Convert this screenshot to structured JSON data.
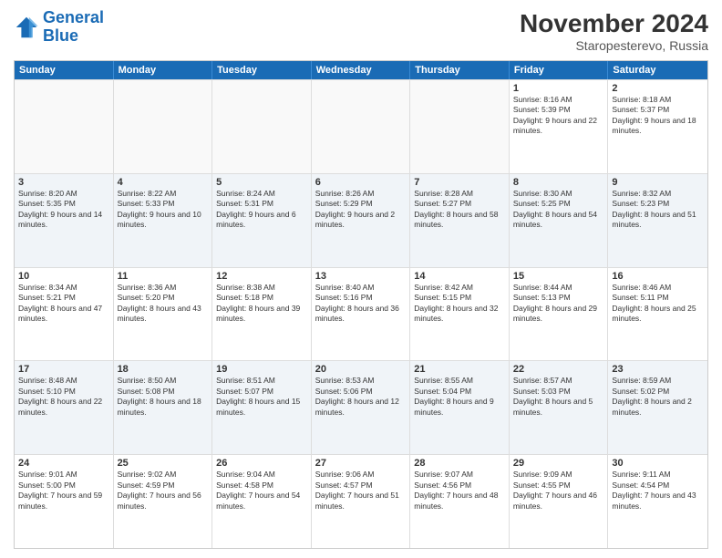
{
  "logo": {
    "text_general": "General",
    "text_blue": "Blue"
  },
  "header": {
    "title": "November 2024",
    "subtitle": "Staropesterevo, Russia"
  },
  "days_of_week": [
    "Sunday",
    "Monday",
    "Tuesday",
    "Wednesday",
    "Thursday",
    "Friday",
    "Saturday"
  ],
  "weeks": [
    [
      {
        "day": "",
        "info": "",
        "empty": true
      },
      {
        "day": "",
        "info": "",
        "empty": true
      },
      {
        "day": "",
        "info": "",
        "empty": true
      },
      {
        "day": "",
        "info": "",
        "empty": true
      },
      {
        "day": "",
        "info": "",
        "empty": true
      },
      {
        "day": "1",
        "info": "Sunrise: 8:16 AM\nSunset: 5:39 PM\nDaylight: 9 hours and 22 minutes.",
        "empty": false
      },
      {
        "day": "2",
        "info": "Sunrise: 8:18 AM\nSunset: 5:37 PM\nDaylight: 9 hours and 18 minutes.",
        "empty": false
      }
    ],
    [
      {
        "day": "3",
        "info": "Sunrise: 8:20 AM\nSunset: 5:35 PM\nDaylight: 9 hours and 14 minutes.",
        "empty": false
      },
      {
        "day": "4",
        "info": "Sunrise: 8:22 AM\nSunset: 5:33 PM\nDaylight: 9 hours and 10 minutes.",
        "empty": false
      },
      {
        "day": "5",
        "info": "Sunrise: 8:24 AM\nSunset: 5:31 PM\nDaylight: 9 hours and 6 minutes.",
        "empty": false
      },
      {
        "day": "6",
        "info": "Sunrise: 8:26 AM\nSunset: 5:29 PM\nDaylight: 9 hours and 2 minutes.",
        "empty": false
      },
      {
        "day": "7",
        "info": "Sunrise: 8:28 AM\nSunset: 5:27 PM\nDaylight: 8 hours and 58 minutes.",
        "empty": false
      },
      {
        "day": "8",
        "info": "Sunrise: 8:30 AM\nSunset: 5:25 PM\nDaylight: 8 hours and 54 minutes.",
        "empty": false
      },
      {
        "day": "9",
        "info": "Sunrise: 8:32 AM\nSunset: 5:23 PM\nDaylight: 8 hours and 51 minutes.",
        "empty": false
      }
    ],
    [
      {
        "day": "10",
        "info": "Sunrise: 8:34 AM\nSunset: 5:21 PM\nDaylight: 8 hours and 47 minutes.",
        "empty": false
      },
      {
        "day": "11",
        "info": "Sunrise: 8:36 AM\nSunset: 5:20 PM\nDaylight: 8 hours and 43 minutes.",
        "empty": false
      },
      {
        "day": "12",
        "info": "Sunrise: 8:38 AM\nSunset: 5:18 PM\nDaylight: 8 hours and 39 minutes.",
        "empty": false
      },
      {
        "day": "13",
        "info": "Sunrise: 8:40 AM\nSunset: 5:16 PM\nDaylight: 8 hours and 36 minutes.",
        "empty": false
      },
      {
        "day": "14",
        "info": "Sunrise: 8:42 AM\nSunset: 5:15 PM\nDaylight: 8 hours and 32 minutes.",
        "empty": false
      },
      {
        "day": "15",
        "info": "Sunrise: 8:44 AM\nSunset: 5:13 PM\nDaylight: 8 hours and 29 minutes.",
        "empty": false
      },
      {
        "day": "16",
        "info": "Sunrise: 8:46 AM\nSunset: 5:11 PM\nDaylight: 8 hours and 25 minutes.",
        "empty": false
      }
    ],
    [
      {
        "day": "17",
        "info": "Sunrise: 8:48 AM\nSunset: 5:10 PM\nDaylight: 8 hours and 22 minutes.",
        "empty": false
      },
      {
        "day": "18",
        "info": "Sunrise: 8:50 AM\nSunset: 5:08 PM\nDaylight: 8 hours and 18 minutes.",
        "empty": false
      },
      {
        "day": "19",
        "info": "Sunrise: 8:51 AM\nSunset: 5:07 PM\nDaylight: 8 hours and 15 minutes.",
        "empty": false
      },
      {
        "day": "20",
        "info": "Sunrise: 8:53 AM\nSunset: 5:06 PM\nDaylight: 8 hours and 12 minutes.",
        "empty": false
      },
      {
        "day": "21",
        "info": "Sunrise: 8:55 AM\nSunset: 5:04 PM\nDaylight: 8 hours and 9 minutes.",
        "empty": false
      },
      {
        "day": "22",
        "info": "Sunrise: 8:57 AM\nSunset: 5:03 PM\nDaylight: 8 hours and 5 minutes.",
        "empty": false
      },
      {
        "day": "23",
        "info": "Sunrise: 8:59 AM\nSunset: 5:02 PM\nDaylight: 8 hours and 2 minutes.",
        "empty": false
      }
    ],
    [
      {
        "day": "24",
        "info": "Sunrise: 9:01 AM\nSunset: 5:00 PM\nDaylight: 7 hours and 59 minutes.",
        "empty": false
      },
      {
        "day": "25",
        "info": "Sunrise: 9:02 AM\nSunset: 4:59 PM\nDaylight: 7 hours and 56 minutes.",
        "empty": false
      },
      {
        "day": "26",
        "info": "Sunrise: 9:04 AM\nSunset: 4:58 PM\nDaylight: 7 hours and 54 minutes.",
        "empty": false
      },
      {
        "day": "27",
        "info": "Sunrise: 9:06 AM\nSunset: 4:57 PM\nDaylight: 7 hours and 51 minutes.",
        "empty": false
      },
      {
        "day": "28",
        "info": "Sunrise: 9:07 AM\nSunset: 4:56 PM\nDaylight: 7 hours and 48 minutes.",
        "empty": false
      },
      {
        "day": "29",
        "info": "Sunrise: 9:09 AM\nSunset: 4:55 PM\nDaylight: 7 hours and 46 minutes.",
        "empty": false
      },
      {
        "day": "30",
        "info": "Sunrise: 9:11 AM\nSunset: 4:54 PM\nDaylight: 7 hours and 43 minutes.",
        "empty": false
      }
    ]
  ]
}
